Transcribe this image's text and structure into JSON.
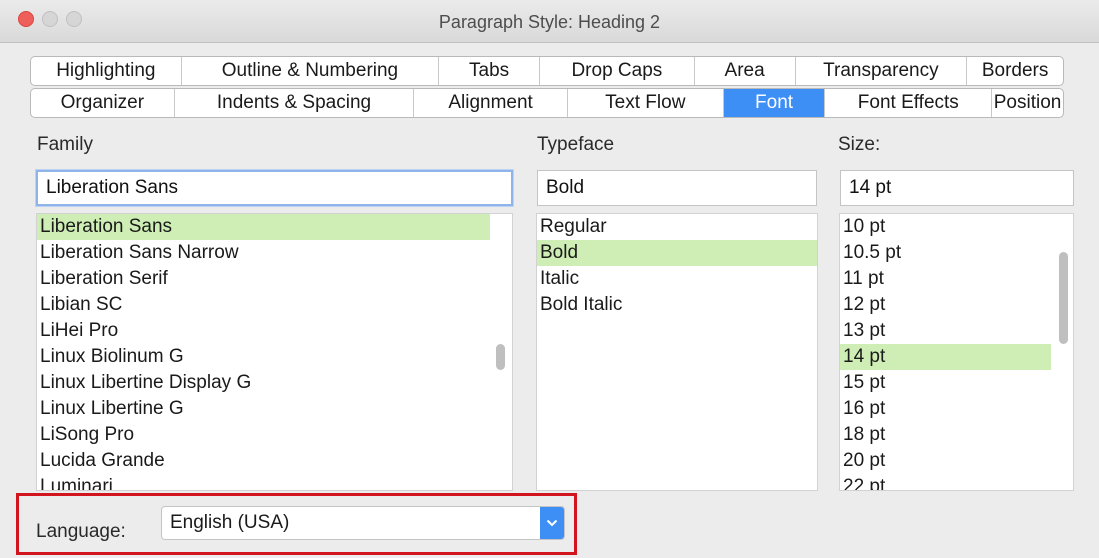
{
  "window": {
    "title": "Paragraph Style: Heading 2"
  },
  "tabs": {
    "row1": [
      "Highlighting",
      "Outline & Numbering",
      "Tabs",
      "Drop Caps",
      "Area",
      "Transparency",
      "Borders"
    ],
    "row2": [
      "Organizer",
      "Indents & Spacing",
      "Alignment",
      "Text Flow",
      "Font",
      "Font Effects",
      "Position"
    ],
    "active": "Font"
  },
  "family": {
    "label": "Family",
    "value": "Liberation Sans",
    "items": [
      "Liberation Sans",
      "Liberation Sans Narrow",
      "Liberation Serif",
      "Libian SC",
      "LiHei Pro",
      "Linux Biolinum G",
      "Linux Libertine Display G",
      "Linux Libertine G",
      "LiSong Pro",
      "Lucida Grande",
      "Luminari"
    ],
    "selected": "Liberation Sans"
  },
  "typeface": {
    "label": "Typeface",
    "value": "Bold",
    "items": [
      "Regular",
      "Bold",
      "Italic",
      "Bold Italic"
    ],
    "selected": "Bold"
  },
  "size": {
    "label": "Size:",
    "value": "14 pt",
    "items": [
      "10 pt",
      "10.5 pt",
      "11 pt",
      "12 pt",
      "13 pt",
      "14 pt",
      "15 pt",
      "16 pt",
      "18 pt",
      "20 pt",
      "22 pt"
    ],
    "selected": "14 pt"
  },
  "language": {
    "label": "Language:",
    "value": "English (USA)"
  },
  "colors": {
    "accent": "#3d8ff5",
    "selection": "#cfeeb5",
    "highlight_box": "#d2141f"
  }
}
